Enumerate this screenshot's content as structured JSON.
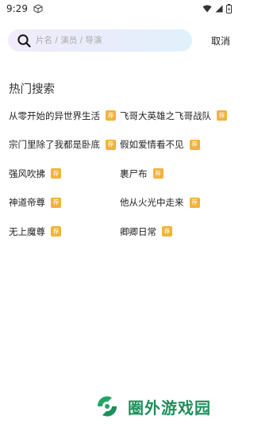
{
  "status_bar": {
    "time": "9:29"
  },
  "search": {
    "placeholder": "片名 / 演员 / 导演",
    "cancel_label": "取消"
  },
  "hot_search": {
    "title": "热门搜索",
    "tag_label": "荐",
    "items": [
      {
        "label": "从零开始的异世界生活"
      },
      {
        "label": "飞哥大英雄之飞哥战队"
      },
      {
        "label": "宗门里除了我都是卧底"
      },
      {
        "label": "假如爱情看不见"
      },
      {
        "label": "强风吹拂"
      },
      {
        "label": "裹尸布"
      },
      {
        "label": "神道帝尊"
      },
      {
        "label": "他从火光中走来"
      },
      {
        "label": "无上魔尊"
      },
      {
        "label": "卿卿日常"
      }
    ]
  },
  "watermark": {
    "text": "圈外游戏园"
  },
  "colors": {
    "tag": "#f2b23a",
    "watermark": "#1d8f5a"
  }
}
